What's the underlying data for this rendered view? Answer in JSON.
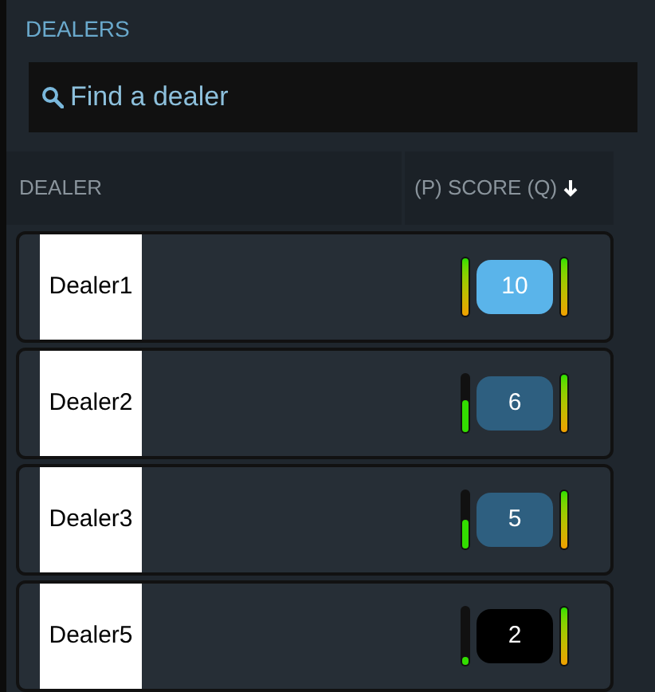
{
  "section_title": "DEALERS",
  "search": {
    "placeholder": "Find a dealer"
  },
  "table": {
    "columns": [
      {
        "label": "DEALER"
      },
      {
        "label": "(P) SCORE (Q)",
        "sorted": true
      }
    ],
    "rows": [
      {
        "dealer": "Dealer1",
        "score": "10",
        "color": "#5ab4ea",
        "p_meter": {
          "level": 1
        },
        "q_meter": {
          "level": 1
        }
      },
      {
        "dealer": "Dealer2",
        "score": "6",
        "color": "#2e5f80",
        "p_meter": {
          "level": 0.55
        },
        "q_meter": {
          "level": 1
        }
      },
      {
        "dealer": "Dealer3",
        "score": "5",
        "color": "#2e5f80",
        "p_meter": {
          "level": 0.5
        },
        "q_meter": {
          "level": 1
        }
      },
      {
        "dealer": "Dealer5",
        "score": "2",
        "color": "#000000",
        "p_meter": {
          "level": 0.15
        },
        "q_meter": {
          "level": 1
        }
      }
    ]
  }
}
